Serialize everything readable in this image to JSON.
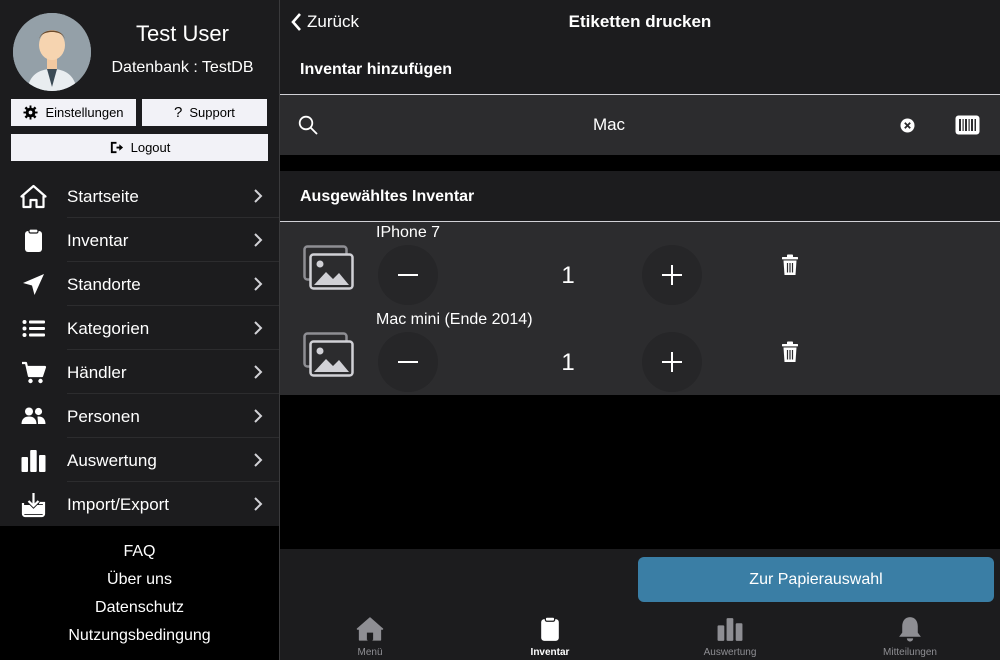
{
  "sidebar": {
    "profile": {
      "name": "Test User",
      "database": "Datenbank : TestDB"
    },
    "buttons": {
      "settings": "Einstellungen",
      "support": "Support",
      "logout": "Logout"
    },
    "nav": [
      {
        "label": "Startseite",
        "icon": "home-icon"
      },
      {
        "label": "Inventar",
        "icon": "clipboard-icon"
      },
      {
        "label": "Standorte",
        "icon": "location-arrow-icon"
      },
      {
        "label": "Kategorien",
        "icon": "list-icon"
      },
      {
        "label": "Händler",
        "icon": "cart-icon"
      },
      {
        "label": "Personen",
        "icon": "people-icon"
      },
      {
        "label": "Auswertung",
        "icon": "bar-chart-icon"
      },
      {
        "label": "Import/Export",
        "icon": "download-icon"
      }
    ],
    "footer": [
      "FAQ",
      "Über uns",
      "Datenschutz",
      "Nutzungsbedingung"
    ]
  },
  "header": {
    "back_label": "Zurück",
    "title": "Etiketten drucken"
  },
  "add_section": {
    "title": "Inventar hinzufügen",
    "search_value": "Mac"
  },
  "selected_section": {
    "title": "Ausgewähltes Inventar",
    "items": [
      {
        "name": "IPhone 7",
        "quantity": "1"
      },
      {
        "name": "Mac mini (Ende 2014)",
        "quantity": "1"
      }
    ]
  },
  "actions": {
    "paper_button": "Zur Papierauswahl"
  },
  "tabbar": [
    {
      "label": "Menü",
      "icon": "home-icon",
      "active": false
    },
    {
      "label": "Inventar",
      "icon": "clipboard-icon",
      "active": true
    },
    {
      "label": "Auswertung",
      "icon": "bar-chart-icon",
      "active": false
    },
    {
      "label": "Mitteilungen",
      "icon": "bell-icon",
      "active": false
    }
  ],
  "colors": {
    "accent_button": "#3a7ea5",
    "panel": "#1c1c1e",
    "row": "#2c2c2e"
  }
}
